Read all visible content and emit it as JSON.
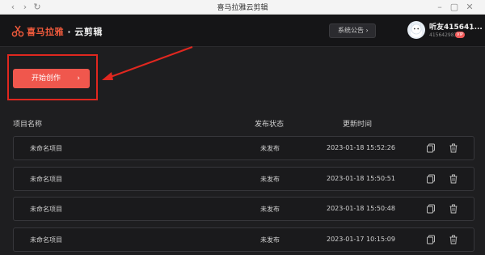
{
  "window": {
    "title": "喜马拉雅云剪辑"
  },
  "header": {
    "logo_brand": "喜马拉雅",
    "logo_sep": "·",
    "logo_product": "云剪辑",
    "notice_label": "系统公告 ›",
    "user_name": "听友415641...",
    "user_id": "415642983",
    "vip_label": "VIP"
  },
  "main": {
    "start_button": "开始创作",
    "start_arrow": "›",
    "columns": {
      "name": "项目名称",
      "status": "发布状态",
      "time": "更新时间"
    },
    "rows": [
      {
        "name": "未命名项目",
        "status": "未发布",
        "time": "2023-01-18 15:52:26"
      },
      {
        "name": "未命名项目",
        "status": "未发布",
        "time": "2023-01-18 15:50:51"
      },
      {
        "name": "未命名项目",
        "status": "未发布",
        "time": "2023-01-18 15:50:48"
      },
      {
        "name": "未命名项目",
        "status": "未发布",
        "time": "2023-01-17 10:15:09"
      }
    ]
  },
  "colors": {
    "accent": "#f0574d",
    "highlight": "#e0271f",
    "background": "#1e1e20"
  }
}
